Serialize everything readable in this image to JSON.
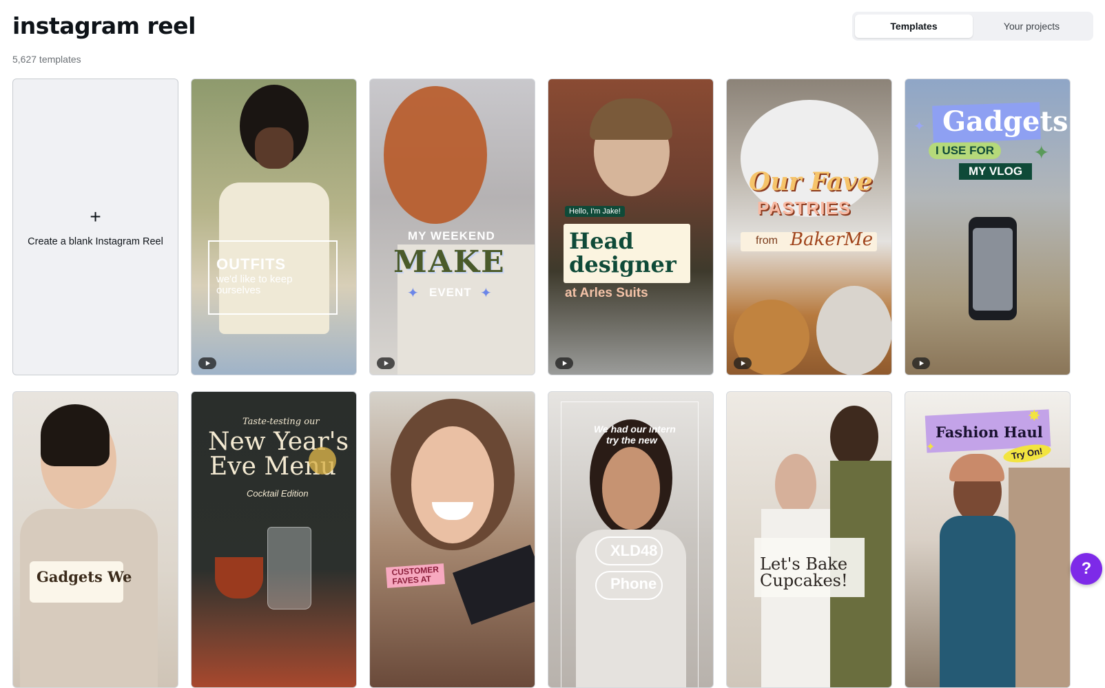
{
  "page": {
    "title": "instagram reel",
    "count": "5,627 templates"
  },
  "tabs": [
    {
      "label": "Templates",
      "active": true
    },
    {
      "label": "Your projects",
      "active": false
    }
  ],
  "blank_card": {
    "label": "Create a blank Instagram Reel",
    "icon": "plus-icon"
  },
  "cards": [
    {
      "lines": [
        "OUTFITS",
        "we'd like to keep",
        "ourselves"
      ],
      "video": true
    },
    {
      "lines": [
        "MY WEEKEND",
        "MAKE",
        "EVENT"
      ],
      "video": true
    },
    {
      "lines": [
        "Hello, I'm Jake!",
        "Head",
        "designer",
        "at Arles Suits"
      ],
      "video": true
    },
    {
      "lines": [
        "Our Fave",
        "PASTRIES",
        "from",
        "BakerMe"
      ],
      "video": true
    },
    {
      "lines": [
        "Gadgets",
        "I USE FOR",
        "MY VLOG"
      ],
      "video": true
    },
    {
      "lines": [
        "Gadgets We"
      ],
      "video": false
    },
    {
      "lines": [
        "Taste-testing our",
        "New Year's",
        "Eve Menu",
        "Cocktail Edition"
      ],
      "video": false
    },
    {
      "lines": [
        "CUSTOMER",
        "FAVES AT"
      ],
      "video": false
    },
    {
      "lines": [
        "We had our intern",
        "try the new",
        "XLD48",
        "Phone"
      ],
      "video": false
    },
    {
      "lines": [
        "Let's Bake",
        "Cupcakes!"
      ],
      "video": false
    },
    {
      "lines": [
        "Fashion Haul",
        "Try On!"
      ],
      "video": false
    }
  ],
  "help": {
    "label": "?"
  },
  "colors": {
    "accent": "#7d2ae8",
    "tab_bg": "#f0f1f4"
  }
}
